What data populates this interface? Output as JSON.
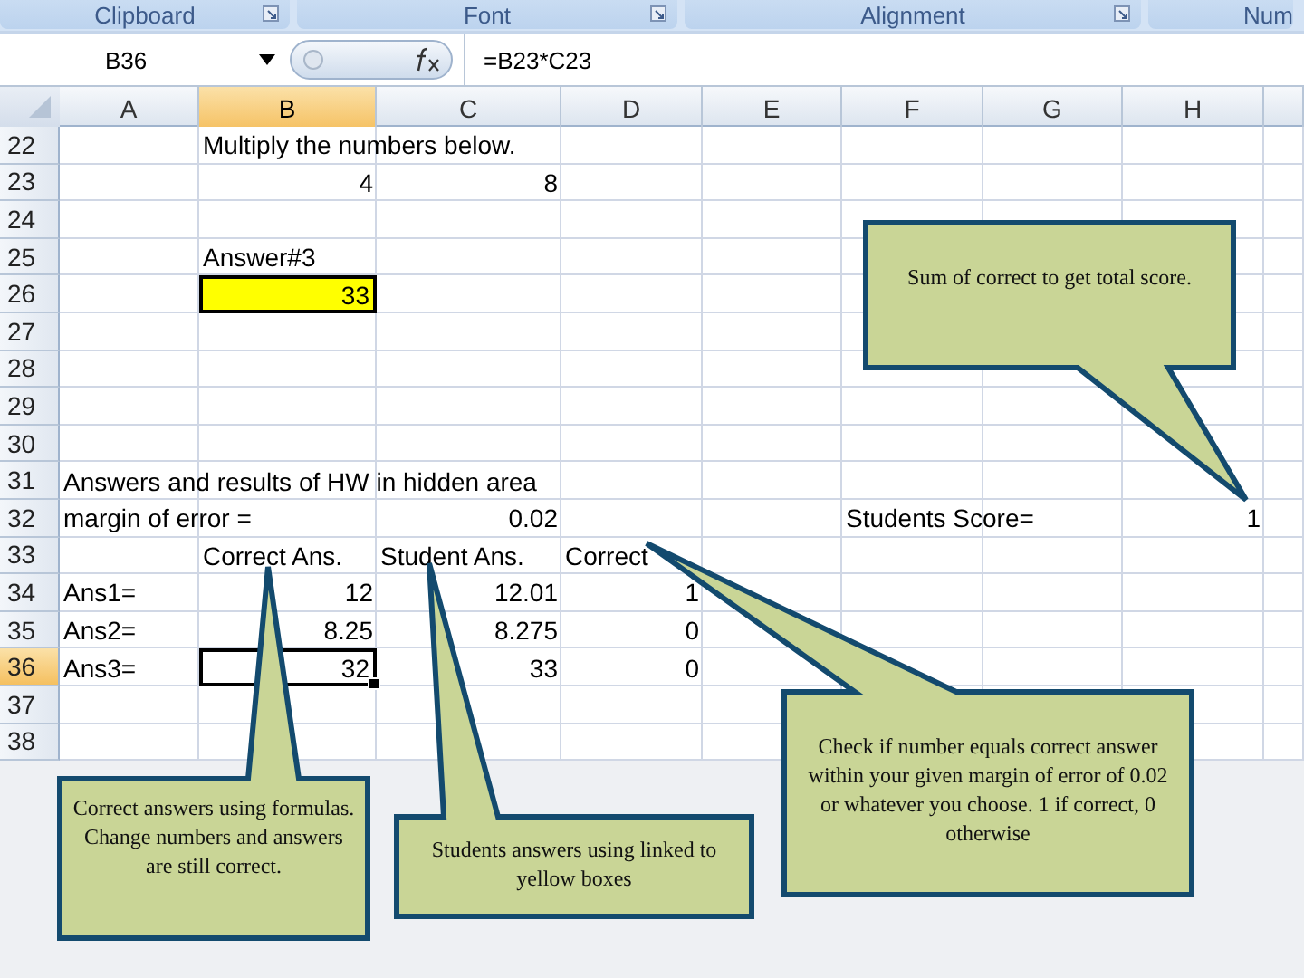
{
  "ribbon_groups": [
    {
      "label": "Clipboard",
      "launcher": true
    },
    {
      "label": "Font",
      "launcher": true
    },
    {
      "label": "Alignment",
      "launcher": true
    },
    {
      "label": "Num",
      "launcher": false
    }
  ],
  "formula_bar": {
    "name_box": "B36",
    "formula": "=B23*C23"
  },
  "columns": [
    {
      "label": "A",
      "selected": false
    },
    {
      "label": "B",
      "selected": true
    },
    {
      "label": "C",
      "selected": false
    },
    {
      "label": "D",
      "selected": false
    },
    {
      "label": "E",
      "selected": false
    },
    {
      "label": "F",
      "selected": false
    },
    {
      "label": "G",
      "selected": false
    },
    {
      "label": "H",
      "selected": false
    }
  ],
  "rows": [
    {
      "number": "22",
      "selected": false,
      "cells": {
        "B": {
          "kind": "text",
          "text": "Multiply the numbers below."
        }
      }
    },
    {
      "number": "23",
      "selected": false,
      "cells": {
        "B": {
          "kind": "number",
          "text": "4"
        },
        "C": {
          "kind": "number",
          "text": "8"
        }
      }
    },
    {
      "number": "24",
      "selected": false
    },
    {
      "number": "25",
      "selected": false,
      "cells": {
        "B": {
          "kind": "text",
          "text": "Answer#3"
        }
      }
    },
    {
      "number": "26",
      "selected": false,
      "cells": {
        "B": {
          "kind": "number",
          "text": "33",
          "highlighted": true
        }
      }
    },
    {
      "number": "27",
      "selected": false
    },
    {
      "number": "28",
      "selected": false
    },
    {
      "number": "29",
      "selected": false
    },
    {
      "number": "30",
      "selected": false
    },
    {
      "number": "31",
      "selected": false,
      "cells": {
        "A": {
          "kind": "text",
          "text": "Answers and results of HW in hidden area"
        }
      }
    },
    {
      "number": "32",
      "selected": false,
      "cells": {
        "A": {
          "kind": "text",
          "text": "margin of error ="
        },
        "C": {
          "kind": "number",
          "text": "0.02"
        },
        "F": {
          "kind": "text",
          "text": "Students Score="
        },
        "H": {
          "kind": "number",
          "text": "1"
        }
      }
    },
    {
      "number": "33",
      "selected": false,
      "cells": {
        "B": {
          "kind": "text",
          "text": "Correct Ans."
        },
        "C": {
          "kind": "text",
          "text": "Student Ans."
        },
        "D": {
          "kind": "text",
          "text": "Correct"
        }
      }
    },
    {
      "number": "34",
      "selected": false,
      "cells": {
        "A": {
          "kind": "text",
          "text": "Ans1="
        },
        "B": {
          "kind": "number",
          "text": "12"
        },
        "C": {
          "kind": "number",
          "text": "12.01"
        },
        "D": {
          "kind": "number",
          "text": "1"
        }
      }
    },
    {
      "number": "35",
      "selected": false,
      "cells": {
        "A": {
          "kind": "text",
          "text": "Ans2="
        },
        "B": {
          "kind": "number",
          "text": "8.25"
        },
        "C": {
          "kind": "number",
          "text": "8.275"
        },
        "D": {
          "kind": "number",
          "text": "0"
        }
      }
    },
    {
      "number": "36",
      "selected": true,
      "cells": {
        "A": {
          "kind": "text",
          "text": "Ans3="
        },
        "B": {
          "kind": "number",
          "text": "32",
          "active": true
        },
        "C": {
          "kind": "number",
          "text": "33"
        },
        "D": {
          "kind": "number",
          "text": "0"
        }
      }
    },
    {
      "number": "37",
      "selected": false
    },
    {
      "number": "38",
      "selected": false
    }
  ],
  "callouts": [
    {
      "text": "Sum of correct to get total score."
    },
    {
      "text": "Check if number equals correct answer within your given margin of error of 0.02 or whatever you choose. 1 if correct, 0 otherwise"
    },
    {
      "text": "Correct answers using formulas.  Change numbers and answers are still correct."
    },
    {
      "text": "Students answers using linked to yellow boxes"
    }
  ]
}
